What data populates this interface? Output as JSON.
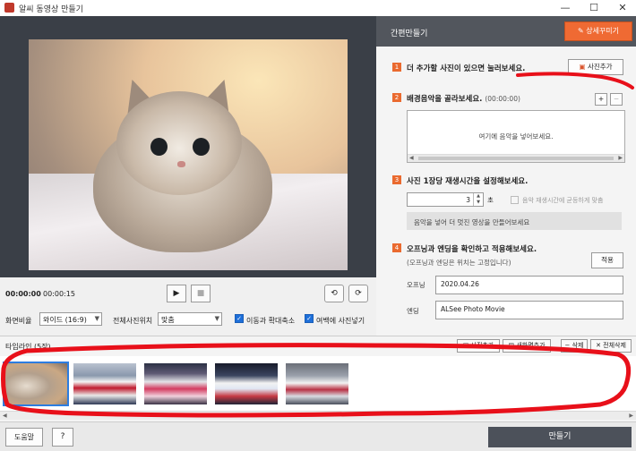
{
  "window": {
    "title": "알씨 동영상 만들기",
    "minimize": "—",
    "maximize": "☐",
    "close": "✕"
  },
  "preview": {
    "time_current": "00:00:00",
    "time_total": "00:00:15",
    "play": "▶",
    "stop": "■",
    "rotate_left": "⟲",
    "rotate_right": "⟳"
  },
  "options": {
    "ratio_label": "화면비율",
    "ratio_value": "와이드 (16:9)",
    "position_label": "전체사진위치",
    "position_value": "맞춤",
    "move_zoom_label": "이동과 확대축소",
    "blank_fill_label": "여백에 사진넣기"
  },
  "panel": {
    "title": "간편만들기",
    "deco_button": "상세꾸미기",
    "step1": {
      "num": "1",
      "text": "더 추가할 사진이 있으면 눌러보세요.",
      "button": "사진추가"
    },
    "step2": {
      "num": "2",
      "text": "배경음악을 골라보세요.",
      "sub": "(00:00:00)",
      "add": "+",
      "remove": "−",
      "hint": "여기에 음악을 넣어보세요."
    },
    "step3": {
      "num": "3",
      "text": "사진 1장당 재생시간을 설정해보세요.",
      "value": "3",
      "unit": "초",
      "fit_label": "음악 재생시간에 균등하게 맞춤",
      "info": "음악을 넣어 더 멋진 영상을 만들어보세요"
    },
    "step4": {
      "num": "4",
      "text": "오프닝과 엔딩을 확인하고 적용해보세요.",
      "sub": "(오프닝과 엔딩은 위치는 고정입니다)",
      "apply": "적용",
      "opening_label": "오프닝",
      "opening_value": "2020.04.26",
      "ending_label": "엔딩",
      "ending_value": "ALSee Photo Movie"
    }
  },
  "timeline": {
    "title": "타임라인 (5장)",
    "add_photo": "사진추가",
    "add_new_screen": "새화면추가",
    "delete": "삭제",
    "delete_all": "전체삭제"
  },
  "bottom": {
    "help": "도움말",
    "question": "?",
    "make": "만들기"
  },
  "colors": {
    "accent": "#ef6a33",
    "header": "#52565d",
    "annotation": "#e8101a"
  }
}
